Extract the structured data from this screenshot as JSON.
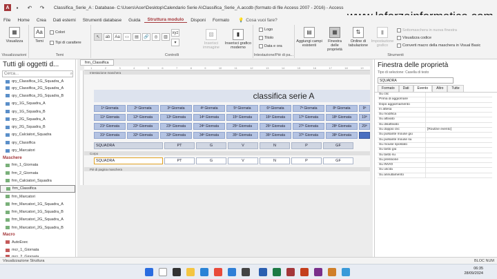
{
  "window": {
    "title": "Classifica_Serie_A : Database- C:\\Users\\Acer\\Desktop\\Calendario Serie A\\Classifica_Serie_A.accdb (formato di file Access 2007 - 2016) - Access",
    "watermark": "www.laforzainformatica.com"
  },
  "menu": {
    "tabs": [
      "File",
      "Home",
      "Crea",
      "Dati esterni",
      "Strumenti database",
      "Guida",
      "Struttura modulo",
      "Disponi",
      "Formato"
    ],
    "active": "Struttura modulo",
    "tell_me": "Cosa vuoi fare?"
  },
  "ribbon": {
    "visualizza": "Visualizza",
    "group_visualizzazioni": "Visualizzazioni",
    "tema": "Temi",
    "colori": "Colori",
    "tipi_carattere": "Tipi di carattere",
    "group_temi": "Temi",
    "group_controlli": "Controlli",
    "inserisci_immagine": "Inserisci immagine",
    "inserisci_grafico": "Inserisci grafico moderno",
    "logo": "Logo",
    "titolo": "Titolo",
    "data_ora": "Data e ora",
    "group_intestazione": "Intestazione/Piè di pa...",
    "aggiungi_campi": "Aggiungi campi esistenti",
    "finestra_proprieta": "Finestra delle proprietà",
    "ordine_tab": "Ordine di tabulazione",
    "impostazione_grafico": "Impostazione grafico",
    "sottomaschera": "Sottomaschera in nuova finestra",
    "visualizza_codice": "Visualizza codice",
    "converti_macro": "Converti macro della maschera in Visual Basic",
    "group_strumenti": "Strumenti"
  },
  "nav": {
    "header": "Tutti gli oggetti d...",
    "search_placeholder": "Cerca...",
    "queries": [
      "qry_Classifica_1G_Squadra_A",
      "qry_Classifica_2G_Squadra_A",
      "qry_Classifica_2G_Squadra_B",
      "qry_1G_Squadra_A",
      "qry_1G_Squadra_B",
      "qry_2G_Squadra_A",
      "qry_2G_Squadra_B",
      "qry_Calciatori_Squadra",
      "qry_Classifica",
      "qry_Marcatori"
    ],
    "section_maschere": "Maschere",
    "forms": [
      "frm_1_Giornata",
      "frm_2_Giornata",
      "frm_Calciatori_Squadra",
      "frm_Classifica",
      "frm_Marcatori",
      "frm_Marcatori_1G_Squadra_A",
      "frm_Marcatori_1G_Squadra_B",
      "frm_Marcatori_2G_Squadra_A",
      "frm_Marcatori_2G_Squadra_B"
    ],
    "selected_form": "frm_Classifica",
    "section_macro": "Macro",
    "macros": [
      "AutoExec",
      "mcr_1_Giornata",
      "mcr_2_Giornata"
    ]
  },
  "document": {
    "tab": "frm_Classifica",
    "section_header": "Intestazione maschera",
    "form_title": "classifica serie A",
    "giornate_row1": [
      "1ª Giornata",
      "2ª Giornata",
      "3ª Giornata",
      "4ª Giornata",
      "5ª Giornata",
      "6ª Giornata",
      "7ª Giornata",
      "8ª Giornata",
      "9ª"
    ],
    "giornate_row2": [
      "11ª Giornata",
      "12ª Giornata",
      "13ª Giornata",
      "14ª Giornata",
      "15ª Giornata",
      "16ª Giornata",
      "17ª Giornata",
      "18ª Giornata",
      "19ª"
    ],
    "giornate_row3": [
      "21ª Giornata",
      "22ª Giornata",
      "23ª Giornata",
      "24ª Giornata",
      "25ª Giornata",
      "26ª Giornata",
      "27ª Giornata",
      "28ª Giornata",
      "29ª"
    ],
    "giornate_row4": [
      "31ª Giornata",
      "32ª Giornata",
      "33ª Giornata",
      "34ª Giornata",
      "35ª Giornata",
      "36ª Giornata",
      "37ª Giornata",
      "38ª Giornata"
    ],
    "columns": [
      "SQUADRA",
      "PT",
      "G",
      "V",
      "N",
      "P",
      "GF"
    ],
    "section_corpo": "Corpo",
    "detail_fields": [
      "SQUADRA",
      "PT",
      "G",
      "V",
      "N",
      "P",
      "GF"
    ],
    "section_footer": "Piè di pagina maschera"
  },
  "props": {
    "title": "Finestra delle proprietà",
    "selection_type": "Tipo di selezione: Casella di testo",
    "selected": "SQUADRA",
    "tabs": [
      "Formato",
      "Dati",
      "Evento",
      "Altro",
      "Tutte"
    ],
    "active_tab": "Evento",
    "rows": [
      {
        "k": "Su clic",
        "v": ""
      },
      {
        "k": "Prima di aggiornare",
        "v": ""
      },
      {
        "k": "Dopo aggiornamento",
        "v": ""
      },
      {
        "k": "In attesa",
        "v": ""
      },
      {
        "k": "Su modifica",
        "v": ""
      },
      {
        "k": "Su attivato",
        "v": ""
      },
      {
        "k": "Su disattivato",
        "v": ""
      },
      {
        "k": "Su doppio clic",
        "v": "[Routine evento]"
      },
      {
        "k": "Su pulsante mouse giù",
        "v": ""
      },
      {
        "k": "Su pulsante mouse su",
        "v": ""
      },
      {
        "k": "Su mouse spostato",
        "v": ""
      },
      {
        "k": "Su tasto giù",
        "v": ""
      },
      {
        "k": "Su tasto su",
        "v": ""
      },
      {
        "k": "Su pressione",
        "v": ""
      },
      {
        "k": "Su INVIO",
        "v": ""
      },
      {
        "k": "Su uscita",
        "v": ""
      },
      {
        "k": "Su annullamento",
        "v": ""
      }
    ]
  },
  "status": {
    "left": "Visualizzazione Struttura",
    "right": "BLOC NUM"
  },
  "taskbar": {
    "time": "06:35",
    "date": "28/09/2024"
  }
}
